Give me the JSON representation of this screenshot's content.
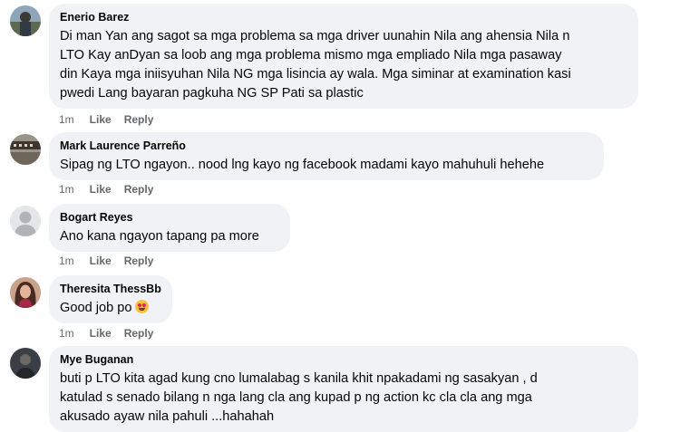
{
  "comments": [
    {
      "name": "Enerio Barez",
      "lines": [
        "Di man Yan ang sagot sa mga problema sa mga driver uunahin Nila ang ahensia Nila n",
        "LTO Kay anDyan sa loob ang mga problema mismo mga empliado Nila mga pasaway",
        "din Kaya mga iniisyuhan Nila NG mga lisincia ay wala. Mga siminar at examination kasi",
        "pwedi Lang bayaran pagkuha NG SP Pati sa plastic"
      ],
      "time": "1m",
      "like": "Like",
      "reply": "Reply",
      "avatar_icon": "profile-photo-landscape"
    },
    {
      "name": "Mark Laurence Parreño",
      "lines": [
        "Sipag ng LTO ngayon.. nood lng kayo ng facebook madami kayo mahuhuli hehehe"
      ],
      "time": "1m",
      "like": "Like",
      "reply": "Reply",
      "avatar_icon": "profile-photo-sign"
    },
    {
      "name": "Bogart Reyes",
      "lines": [
        "Ano kana ngayon tapang pa more"
      ],
      "time": "1m",
      "like": "Like",
      "reply": "Reply",
      "avatar_icon": "default-user-silhouette"
    },
    {
      "name": "Theresita ThessBb",
      "lines": [
        "Good job po"
      ],
      "emoji": "heart-eyes-emoji",
      "time": "1m",
      "like": "Like",
      "reply": "Reply",
      "avatar_icon": "profile-photo-woman"
    },
    {
      "name": "Mye Buganan",
      "lines": [
        "buti p LTO kita agad kung cno lumalabag s kanila khit npakadami ng sasakyan , d",
        "katulad s senado bilang n nga lang cla ang kupad p ng action kc cla cla ang mga",
        "akusado ayaw nila pahuli ...hahahah"
      ],
      "avatar_icon": "profile-photo-dark"
    }
  ]
}
